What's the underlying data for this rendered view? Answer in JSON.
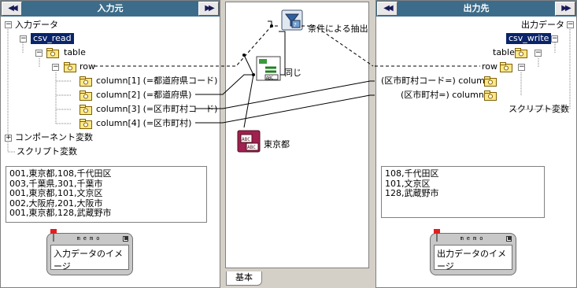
{
  "left_panel": {
    "title": "入力元",
    "tree": {
      "root": "入力データ",
      "csv": "csv_read",
      "table": "table",
      "row": "row",
      "columns": [
        "column[1] (=都道府県コード)",
        "column[2] (=都道府県)",
        "column[3] (=区市町村コード)",
        "column[4] (=区市町村)"
      ],
      "component_vars": "コンポーネント変数",
      "script_vars": "スクリプト変数"
    },
    "data_lines": [
      "001,東京都,108,千代田区",
      "003,千葉県,301,千葉市",
      "001,東京都,101,文京区",
      "002,大阪府,201,大阪市",
      "001,東京都,128,武蔵野市"
    ],
    "memo_head": "memo",
    "memo_text": "入力データのイメージ"
  },
  "middle": {
    "filter_label": "条件による抽出",
    "equal_label": "同じ",
    "const_label": "東京都",
    "tab_label": "基本"
  },
  "right_panel": {
    "title": "出力先",
    "tree": {
      "root": "出力データ",
      "csv": "csv_write",
      "table": "table",
      "row": "row",
      "columns": [
        "(区市町村コード=) column",
        "(区市町村=) column"
      ],
      "script_vars": "スクリプト変数"
    },
    "data_lines": [
      "108,千代田区",
      "101,文京区",
      "128,武蔵野市"
    ],
    "memo_head": "memo",
    "memo_text": "出力データのイメージ"
  },
  "nav": {
    "prev": "◀◀",
    "next": "▶▶"
  }
}
